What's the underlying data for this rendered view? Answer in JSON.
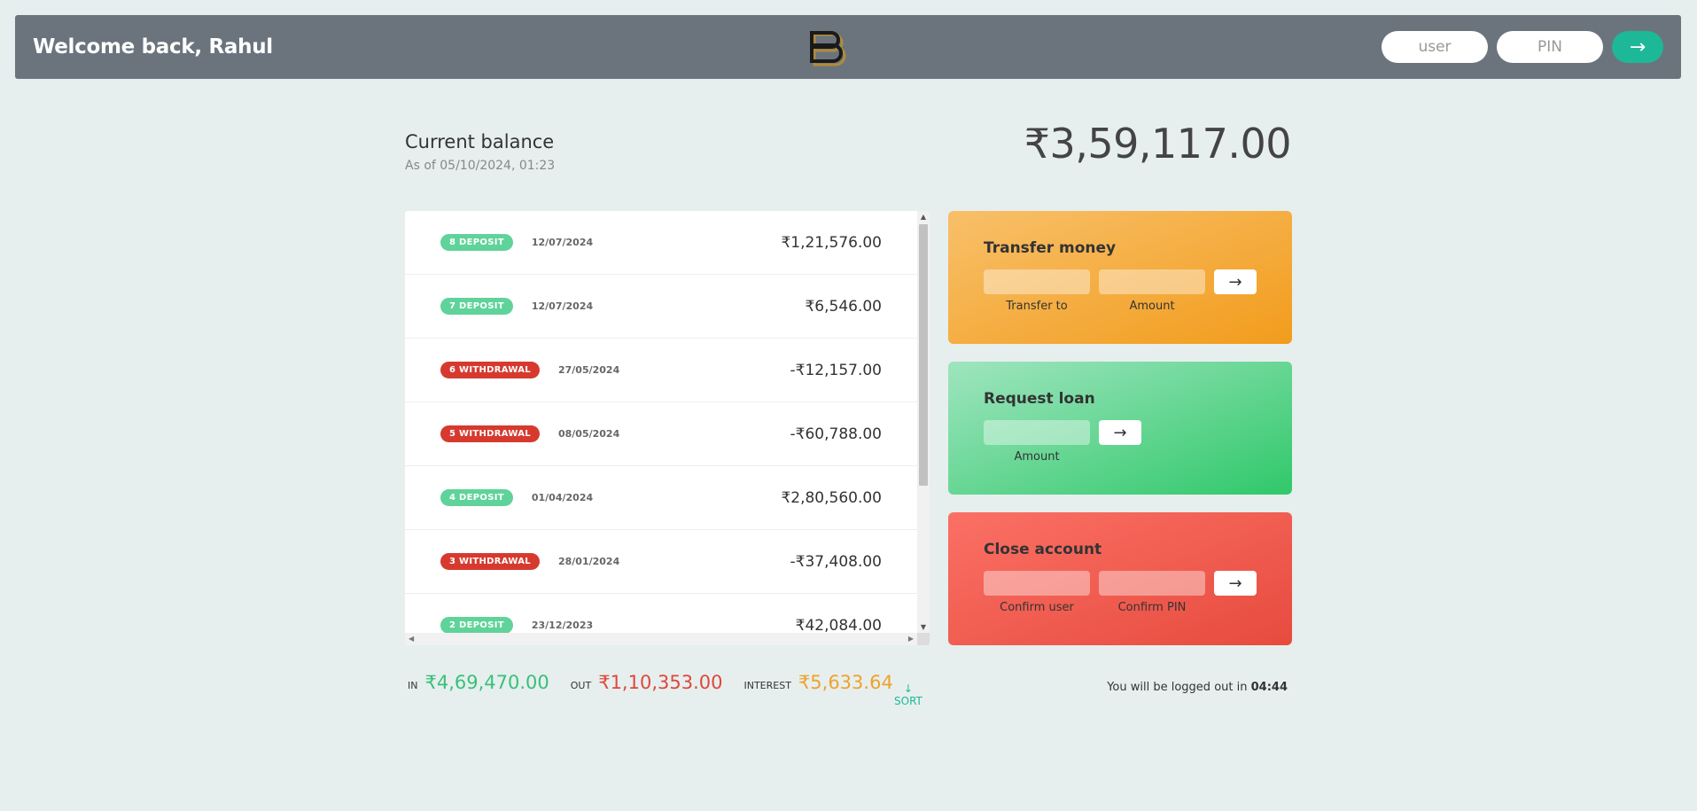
{
  "header": {
    "welcome": "Welcome back, Rahul",
    "user_placeholder": "user",
    "pin_placeholder": "PIN",
    "login_button": "→"
  },
  "balance": {
    "label": "Current balance",
    "date": "As of 05/10/2024, 01:23",
    "value": "₹3,59,117.00"
  },
  "movements": [
    {
      "type": "8 DEPOSIT",
      "kind": "deposit",
      "date": "12/07/2024",
      "value": "₹1,21,576.00"
    },
    {
      "type": "7 DEPOSIT",
      "kind": "deposit",
      "date": "12/07/2024",
      "value": "₹6,546.00"
    },
    {
      "type": "6 WITHDRAWAL",
      "kind": "withdrawal",
      "date": "27/05/2024",
      "value": "-₹12,157.00"
    },
    {
      "type": "5 WITHDRAWAL",
      "kind": "withdrawal",
      "date": "08/05/2024",
      "value": "-₹60,788.00"
    },
    {
      "type": "4 DEPOSIT",
      "kind": "deposit",
      "date": "01/04/2024",
      "value": "₹2,80,560.00"
    },
    {
      "type": "3 WITHDRAWAL",
      "kind": "withdrawal",
      "date": "28/01/2024",
      "value": "-₹37,408.00"
    },
    {
      "type": "2 DEPOSIT",
      "kind": "deposit",
      "date": "23/12/2023",
      "value": "₹42,084.00"
    }
  ],
  "transfer": {
    "title": "Transfer money",
    "to_label": "Transfer to",
    "amount_label": "Amount",
    "button": "→"
  },
  "loan": {
    "title": "Request loan",
    "amount_label": "Amount",
    "button": "→"
  },
  "close": {
    "title": "Close account",
    "user_label": "Confirm user",
    "pin_label": "Confirm PIN",
    "button": "→"
  },
  "summary": {
    "in_label": "In",
    "in_value": "₹4,69,470.00",
    "out_label": "Out",
    "out_value": "₹1,10,353.00",
    "interest_label": "Interest",
    "interest_value": "₹5,633.64",
    "sort_arrow": "↓",
    "sort_label": "SORT"
  },
  "logout": {
    "prefix": "You will be logged out in ",
    "timer": "04:44"
  },
  "colors": {
    "accent": "#1db897",
    "deposit": "#5fd39a",
    "withdrawal": "#d63a2f",
    "header_bg": "#6b747d"
  }
}
